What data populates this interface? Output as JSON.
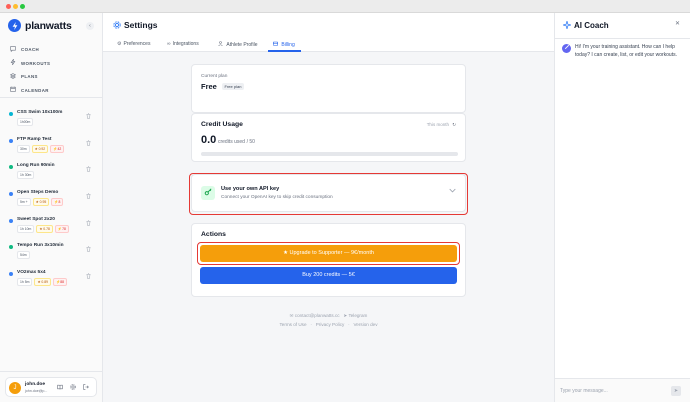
{
  "window": {
    "controls": [
      "close",
      "minimize",
      "maximize"
    ]
  },
  "colors": {
    "accent": "#2563eb",
    "upgrade": "#f59e0b",
    "highlight": "#e53935",
    "close": "#ff5f57",
    "minimize": "#febc2e",
    "maximize": "#28c840"
  },
  "sidebar": {
    "brand": "planwatts",
    "collapse_icon": "chevron-left-icon",
    "nav": [
      {
        "label": "COACH",
        "icon": "chat-icon"
      },
      {
        "label": "WORKOUTS",
        "icon": "bolt-icon"
      },
      {
        "label": "PLANS",
        "icon": "layers-icon"
      },
      {
        "label": "CALENDAR",
        "icon": "calendar-icon"
      }
    ],
    "workouts": [
      {
        "title": "CSS Swim 10x100m",
        "sport": "swim",
        "duration": "1h00m",
        "if": "",
        "tss": ""
      },
      {
        "title": "FTP Ramp Test",
        "sport": "bike",
        "duration": "30m",
        "if": "0.92",
        "tss": "42"
      },
      {
        "title": "Long Run 90min",
        "sport": "run",
        "duration": "1h 30m",
        "if": "",
        "tss": ""
      },
      {
        "title": "Open Steps Demo",
        "sport": "bike",
        "duration": "5m +",
        "if": "0.95",
        "tss": "8"
      },
      {
        "title": "Sweet Spot 2x20",
        "sport": "bike",
        "duration": "1h 10m",
        "if": "0.78",
        "tss": "78"
      },
      {
        "title": "Tempo Run 3x10min",
        "sport": "run",
        "duration": "54m",
        "if": "",
        "tss": ""
      },
      {
        "title": "VO2max 5x4",
        "sport": "bike",
        "duration": "1h 5m",
        "if": "0.89",
        "tss": "88"
      }
    ],
    "user": {
      "name": "john.doe",
      "email": "john.doe@p...",
      "avatar_initial": "J"
    }
  },
  "header": {
    "title": "Settings"
  },
  "tabs": [
    {
      "label": "Preferences",
      "icon": "gear-icon",
      "active": false
    },
    {
      "label": "Integrations",
      "icon": "link-icon",
      "active": false
    },
    {
      "label": "Athlete Profile",
      "icon": "user-icon",
      "active": false
    },
    {
      "label": "Billing",
      "icon": "card-icon",
      "active": true
    }
  ],
  "billing": {
    "current_plan": {
      "label": "Current plan",
      "name": "Free",
      "badge": "Free plan"
    },
    "credit_usage": {
      "title": "Credit Usage",
      "period": "This month",
      "used": "0.0",
      "used_label": "credits used",
      "limit": "/ 50",
      "progress": 0
    },
    "api_key": {
      "title": "Use your own API key",
      "subtitle": "Connect your OpenAI key to skip credit consumption"
    },
    "actions": {
      "title": "Actions",
      "upgrade_label": "Upgrade to Supporter — 9€/month",
      "buy_label": "Buy 200 credits — 5€"
    },
    "footer": {
      "email": "contact@planwatts.cc",
      "telegram": "Telegram",
      "terms": "Terms of Use",
      "privacy": "Privacy Policy",
      "version": "Version dev"
    }
  },
  "coach": {
    "title": "AI Coach",
    "message": "Hi! I'm your training assistant. How can I help today? I can create, list, or edit your workouts.",
    "input_placeholder": "Type your message..."
  }
}
